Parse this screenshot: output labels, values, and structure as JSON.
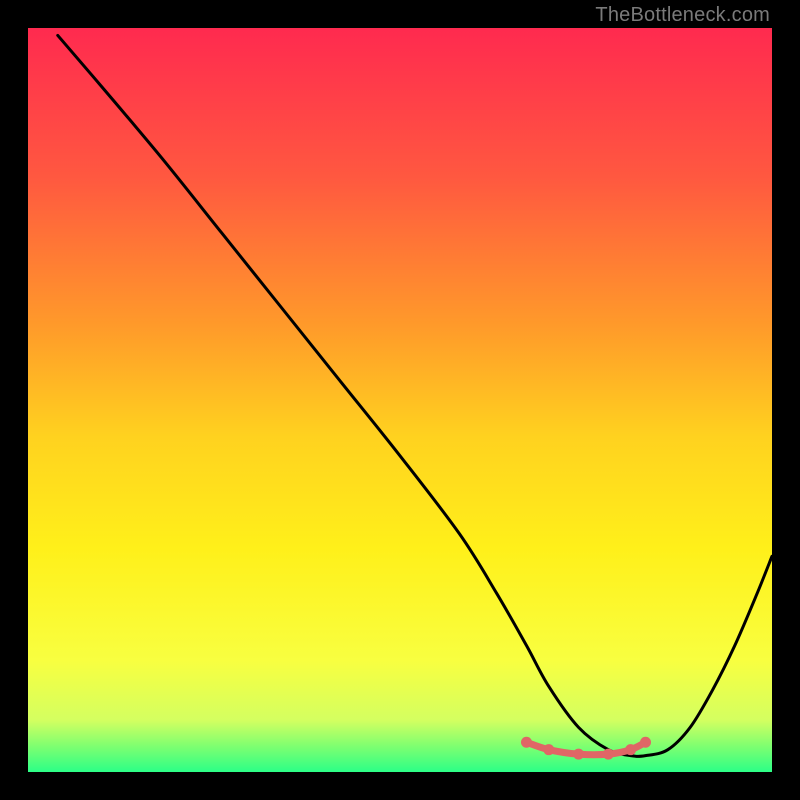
{
  "watermark": "TheBottleneck.com",
  "chart_data": {
    "type": "line",
    "title": "",
    "xlabel": "",
    "ylabel": "",
    "xlim": [
      0,
      100
    ],
    "ylim": [
      0,
      100
    ],
    "grid": false,
    "legend": false,
    "background_gradient": {
      "stops": [
        {
          "offset": 0.0,
          "color": "#ff2a4f"
        },
        {
          "offset": 0.2,
          "color": "#ff5840"
        },
        {
          "offset": 0.4,
          "color": "#ff9a2a"
        },
        {
          "offset": 0.55,
          "color": "#ffd21f"
        },
        {
          "offset": 0.7,
          "color": "#fff01a"
        },
        {
          "offset": 0.85,
          "color": "#f8ff40"
        },
        {
          "offset": 0.93,
          "color": "#d4ff60"
        },
        {
          "offset": 0.965,
          "color": "#7fff70"
        },
        {
          "offset": 1.0,
          "color": "#2cff87"
        }
      ]
    },
    "curve": {
      "x": [
        4,
        10,
        18,
        26,
        34,
        42,
        50,
        58,
        63,
        67,
        70,
        74,
        78,
        81,
        83,
        86,
        89,
        92,
        95,
        98,
        100
      ],
      "y": [
        99,
        92,
        82.5,
        72.5,
        62.5,
        52.5,
        42.5,
        32,
        24,
        17,
        11.5,
        6,
        3,
        2.2,
        2.2,
        3,
        6,
        11,
        17,
        24,
        29
      ]
    },
    "marker_segment": {
      "color": "#e06666",
      "x": [
        67,
        70,
        74,
        78,
        81,
        83
      ],
      "y": [
        4.0,
        3.0,
        2.4,
        2.4,
        3.0,
        4.0
      ]
    }
  }
}
